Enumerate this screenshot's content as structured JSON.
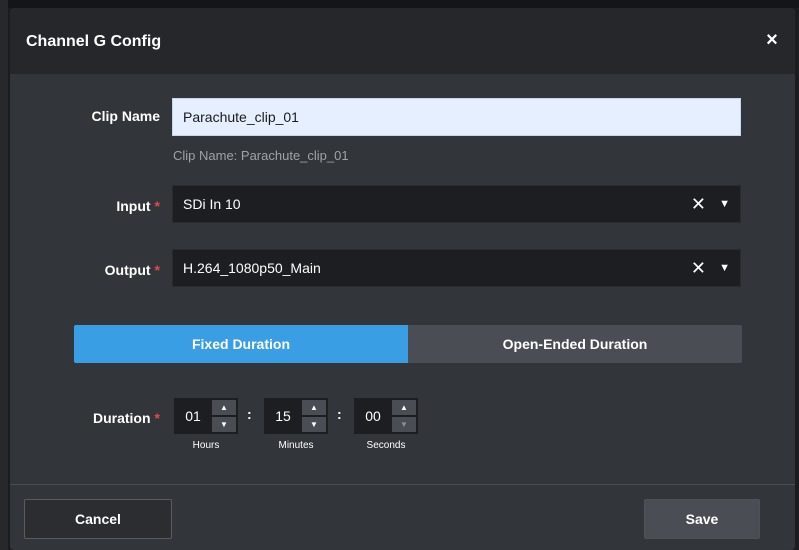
{
  "dialog": {
    "title": "Channel G Config",
    "close_glyph": "×"
  },
  "form": {
    "clip_name": {
      "label": "Clip Name",
      "value": "Parachute_clip_01",
      "hint": "Clip Name: Parachute_clip_01"
    },
    "input": {
      "label": "Input",
      "required_mark": "*",
      "value": "SDi In 10",
      "clear_glyph": "✕",
      "caret_glyph": "▼"
    },
    "output": {
      "label": "Output",
      "required_mark": "*",
      "value": "H.264_1080p50_Main",
      "clear_glyph": "✕",
      "caret_glyph": "▼"
    },
    "duration_mode": {
      "options": [
        "Fixed Duration",
        "Open-Ended Duration"
      ],
      "selected": "Fixed Duration"
    },
    "duration": {
      "label": "Duration",
      "required_mark": "*",
      "hours": "01",
      "minutes": "15",
      "seconds": "00",
      "hours_label": "Hours",
      "minutes_label": "Minutes",
      "seconds_label": "Seconds",
      "separator": ":",
      "up_glyph": "▲",
      "down_glyph": "▼"
    }
  },
  "footer": {
    "cancel_label": "Cancel",
    "save_label": "Save"
  },
  "colors": {
    "accent": "#3a9ee4",
    "required": "#e34a4a",
    "panel": "#323539",
    "header": "#25272b"
  },
  "icons": [
    "close-icon",
    "clear-icon",
    "chevron-down-icon",
    "chevron-up-icon"
  ]
}
